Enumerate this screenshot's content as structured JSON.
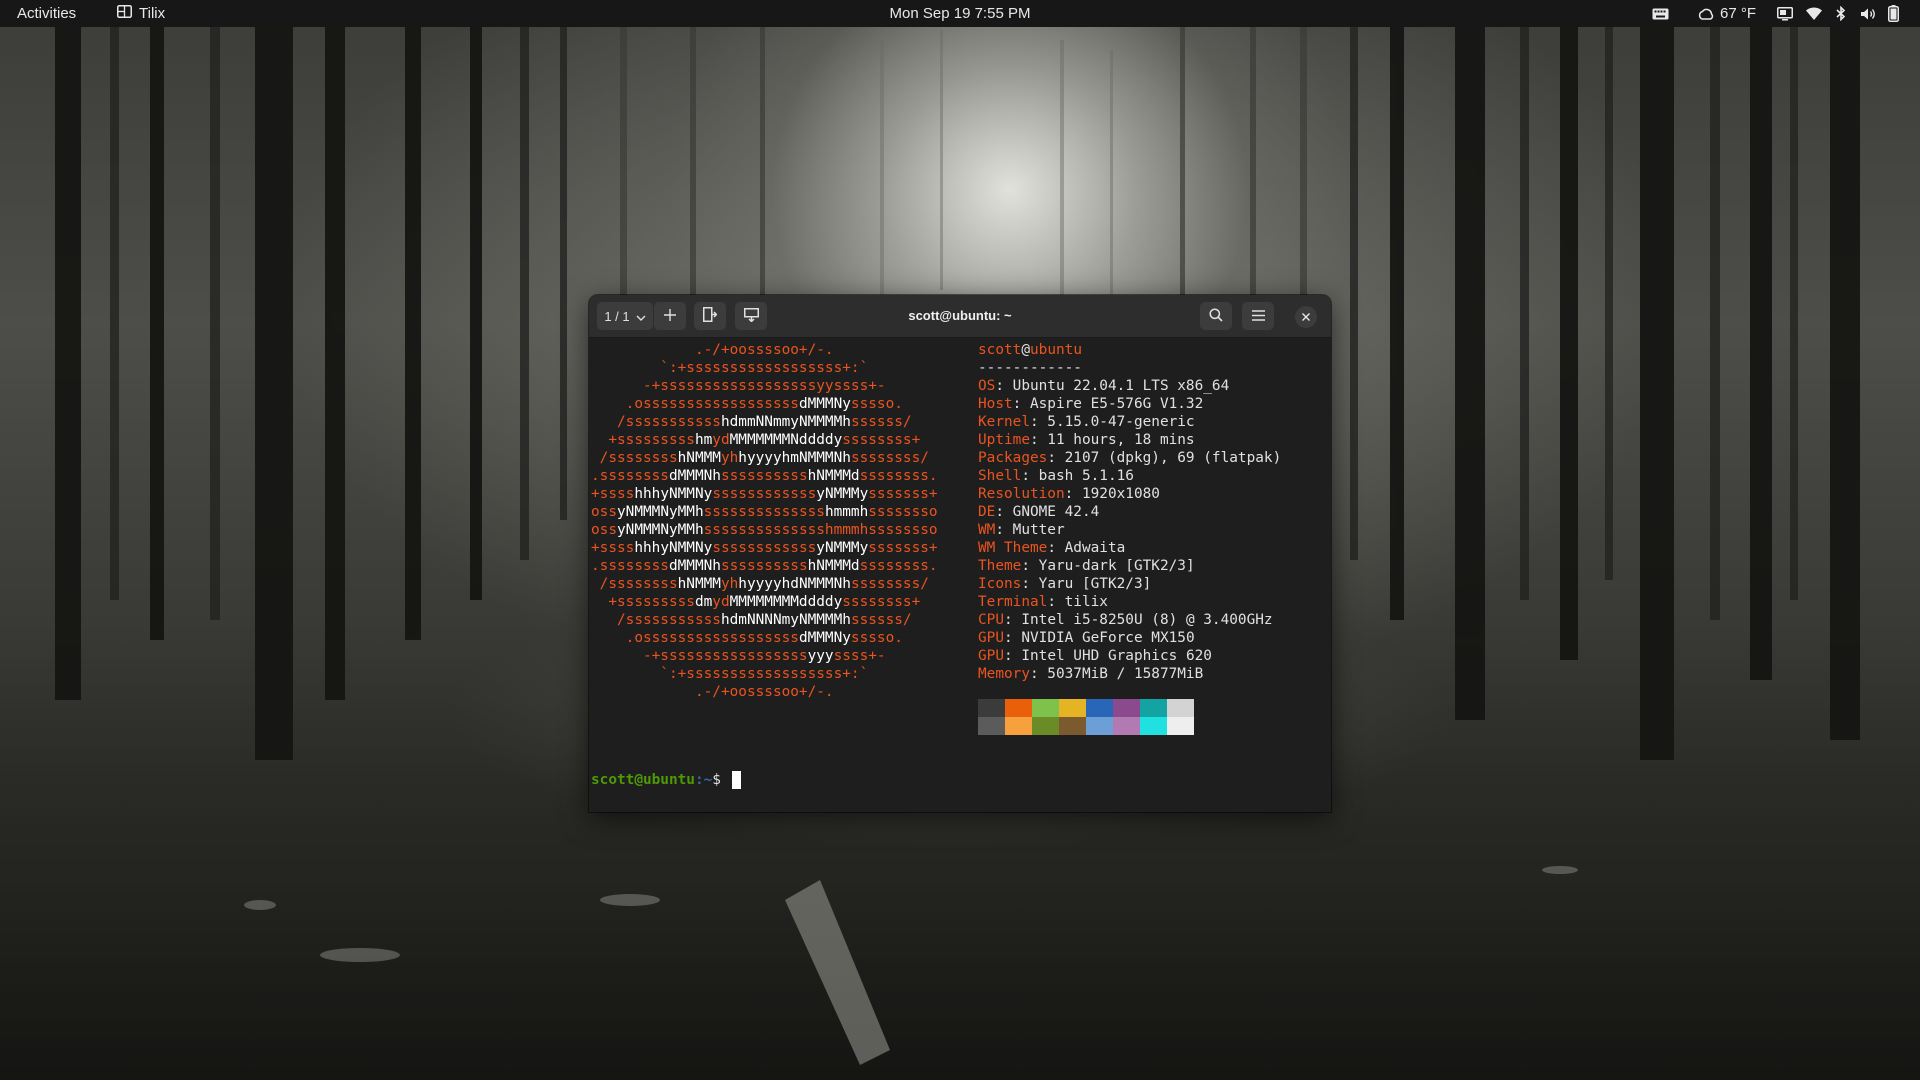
{
  "topbar": {
    "activities": "Activities",
    "app_name": "Tilix",
    "clock": "Mon Sep 19  7:55 PM",
    "weather": "67 °F",
    "icons": [
      "keyboard-icon",
      "weather-icon",
      "screen-share-icon",
      "wifi-icon",
      "bluetooth-icon",
      "volume-icon",
      "battery-icon"
    ]
  },
  "window": {
    "title": "scott@ubuntu: ~",
    "session_label": "1 / 1",
    "icons": [
      "chevron-down-icon",
      "plus-icon",
      "split-horizontal-icon",
      "split-vertical-icon",
      "search-icon",
      "hamburger-menu-icon",
      "close-icon"
    ]
  },
  "terminal": {
    "logo_lines": [
      [
        {
          "t": "            .-/+oossssoo+/-.",
          "c": "o"
        }
      ],
      [
        {
          "t": "        `:+ssssssssssssssssss+:`",
          "c": "o"
        }
      ],
      [
        {
          "t": "      -+ssssssssssssssssssyyssss+-",
          "c": "o"
        }
      ],
      [
        {
          "t": "    .ossssssssssssssssss",
          "c": "o"
        },
        {
          "t": "dMMMNy",
          "c": "w"
        },
        {
          "t": "sssso.",
          "c": "o"
        }
      ],
      [
        {
          "t": "   /sssssssssss",
          "c": "o"
        },
        {
          "t": "hdmmNNmmyNMMMMh",
          "c": "w"
        },
        {
          "t": "ssssss/",
          "c": "o"
        }
      ],
      [
        {
          "t": "  +sssssssss",
          "c": "o"
        },
        {
          "t": "hm",
          "c": "w"
        },
        {
          "t": "yd",
          "c": "o"
        },
        {
          "t": "MMMMMMMNddddy",
          "c": "w"
        },
        {
          "t": "ssssssss+",
          "c": "o"
        }
      ],
      [
        {
          "t": " /ssssssss",
          "c": "o"
        },
        {
          "t": "hNMMM",
          "c": "w"
        },
        {
          "t": "yh",
          "c": "o"
        },
        {
          "t": "hyyyyhmNMMMNh",
          "c": "w"
        },
        {
          "t": "ssssssss/",
          "c": "o"
        }
      ],
      [
        {
          "t": ".ssssssss",
          "c": "o"
        },
        {
          "t": "dMMMNh",
          "c": "w"
        },
        {
          "t": "ssssssssss",
          "c": "o"
        },
        {
          "t": "hNMMMd",
          "c": "w"
        },
        {
          "t": "ssssssss.",
          "c": "o"
        }
      ],
      [
        {
          "t": "+ssss",
          "c": "o"
        },
        {
          "t": "hhhyNMMNy",
          "c": "w"
        },
        {
          "t": "ssssssssssss",
          "c": "o"
        },
        {
          "t": "yNMMMy",
          "c": "w"
        },
        {
          "t": "sssssss+",
          "c": "o"
        }
      ],
      [
        {
          "t": "oss",
          "c": "o"
        },
        {
          "t": "yNMMMNyMMh",
          "c": "w"
        },
        {
          "t": "ssssssssssssss",
          "c": "o"
        },
        {
          "t": "hmmmh",
          "c": "w"
        },
        {
          "t": "ssssssso",
          "c": "o"
        }
      ],
      [
        {
          "t": "oss",
          "c": "o"
        },
        {
          "t": "yNMMMNyMMh",
          "c": "w"
        },
        {
          "t": "sssssssssssssshmmmhssssssso",
          "c": "o"
        }
      ],
      [
        {
          "t": "+ssss",
          "c": "o"
        },
        {
          "t": "hhhyNMMNy",
          "c": "w"
        },
        {
          "t": "ssssssssssss",
          "c": "o"
        },
        {
          "t": "yNMMMy",
          "c": "w"
        },
        {
          "t": "sssssss+",
          "c": "o"
        }
      ],
      [
        {
          "t": ".ssssssss",
          "c": "o"
        },
        {
          "t": "dMMMNh",
          "c": "w"
        },
        {
          "t": "ssssssssss",
          "c": "o"
        },
        {
          "t": "hNMMMd",
          "c": "w"
        },
        {
          "t": "ssssssss.",
          "c": "o"
        }
      ],
      [
        {
          "t": " /ssssssss",
          "c": "o"
        },
        {
          "t": "hNMMM",
          "c": "w"
        },
        {
          "t": "yh",
          "c": "o"
        },
        {
          "t": "hyyyyhdNMMMNh",
          "c": "w"
        },
        {
          "t": "ssssssss/",
          "c": "o"
        }
      ],
      [
        {
          "t": "  +sssssssss",
          "c": "o"
        },
        {
          "t": "dm",
          "c": "w"
        },
        {
          "t": "yd",
          "c": "o"
        },
        {
          "t": "MMMMMMMMddddy",
          "c": "w"
        },
        {
          "t": "ssssssss+",
          "c": "o"
        }
      ],
      [
        {
          "t": "   /sssssssssss",
          "c": "o"
        },
        {
          "t": "hdmNNNNmyNMMMMh",
          "c": "w"
        },
        {
          "t": "ssssss/",
          "c": "o"
        }
      ],
      [
        {
          "t": "    .ossssssssssssssssss",
          "c": "o"
        },
        {
          "t": "dMMMNy",
          "c": "w"
        },
        {
          "t": "sssso.",
          "c": "o"
        }
      ],
      [
        {
          "t": "      -+sssssssssssssssss",
          "c": "o"
        },
        {
          "t": "yyy",
          "c": "w"
        },
        {
          "t": "ssss+-",
          "c": "o"
        }
      ],
      [
        {
          "t": "        `:+ssssssssssssssssss+:`",
          "c": "o"
        }
      ],
      [
        {
          "t": "            .-/+oossssoo+/-.",
          "c": "o"
        }
      ]
    ],
    "user": "scott",
    "at": "@",
    "host": "ubuntu",
    "separator": "------------",
    "info": [
      {
        "k": "OS",
        "v": ": Ubuntu 22.04.1 LTS x86_64"
      },
      {
        "k": "Host",
        "v": ": Aspire E5-576G V1.32"
      },
      {
        "k": "Kernel",
        "v": ": 5.15.0-47-generic"
      },
      {
        "k": "Uptime",
        "v": ": 11 hours, 18 mins"
      },
      {
        "k": "Packages",
        "v": ": 2107 (dpkg), 69 (flatpak)"
      },
      {
        "k": "Shell",
        "v": ": bash 5.1.16"
      },
      {
        "k": "Resolution",
        "v": ": 1920x1080"
      },
      {
        "k": "DE",
        "v": ": GNOME 42.4"
      },
      {
        "k": "WM",
        "v": ": Mutter"
      },
      {
        "k": "WM Theme",
        "v": ": Adwaita"
      },
      {
        "k": "Theme",
        "v": ": Yaru-dark [GTK2/3]"
      },
      {
        "k": "Icons",
        "v": ": Yaru [GTK2/3]"
      },
      {
        "k": "Terminal",
        "v": ": tilix"
      },
      {
        "k": "CPU",
        "v": ": Intel i5-8250U (8) @ 3.400GHz"
      },
      {
        "k": "GPU",
        "v": ": NVIDIA GeForce MX150"
      },
      {
        "k": "GPU",
        "v": ": Intel UHD Graphics 620"
      },
      {
        "k": "Memory",
        "v": ": 5037MiB / 15877MiB"
      }
    ],
    "palette_top": [
      "#3b3b3b",
      "#e95f0a",
      "#7fc24b",
      "#e4b424",
      "#2a66b8",
      "#8c4a8e",
      "#13a3a3",
      "#d3d3d3"
    ],
    "palette_bottom": [
      "#5b5b5b",
      "#f7a13e",
      "#6b8b27",
      "#7a5a2e",
      "#6c9fd6",
      "#b27ab2",
      "#21e0e0",
      "#eeeeee"
    ],
    "prompt_user": "scott@ubuntu",
    "prompt_path": ":~",
    "prompt_symbol": "$ "
  },
  "colors": {
    "accent_orange": "#e95420",
    "prompt_green": "#4e9a06",
    "prompt_blue": "#3465a4"
  }
}
